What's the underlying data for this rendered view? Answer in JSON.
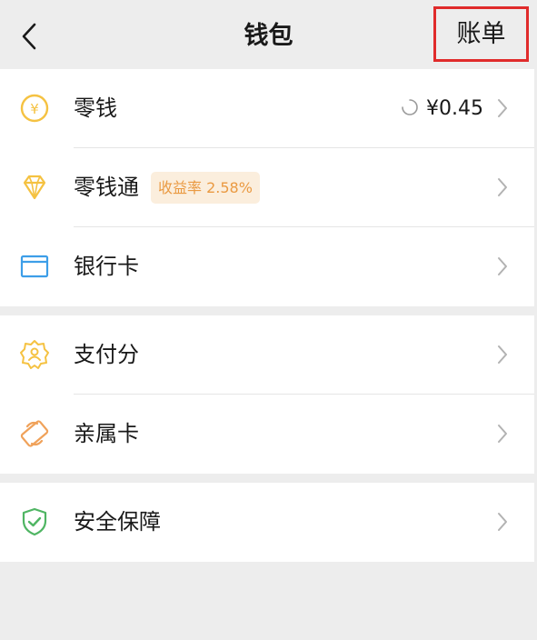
{
  "header": {
    "title": "钱包",
    "bill_button": "账单"
  },
  "groups": [
    {
      "items": [
        {
          "label": "零钱",
          "value": "¥0.45",
          "icon": "yuan-coin-icon"
        },
        {
          "label": "零钱通",
          "badge": "收益率 2.58%",
          "icon": "diamond-icon"
        },
        {
          "label": "银行卡",
          "icon": "bank-card-icon"
        }
      ]
    },
    {
      "items": [
        {
          "label": "支付分",
          "icon": "credit-score-icon"
        },
        {
          "label": "亲属卡",
          "icon": "family-card-icon"
        }
      ]
    },
    {
      "items": [
        {
          "label": "安全保障",
          "icon": "security-shield-icon"
        }
      ]
    }
  ],
  "colors": {
    "background": "#ededed",
    "bill_highlight": "#e02b2b",
    "badge_bg": "#fbeedd",
    "badge_text": "#ea9a42",
    "coin_yellow": "#f5c242",
    "card_blue": "#3d9ee8",
    "shield_green": "#4fb563",
    "family_orange": "#f0a25a"
  }
}
